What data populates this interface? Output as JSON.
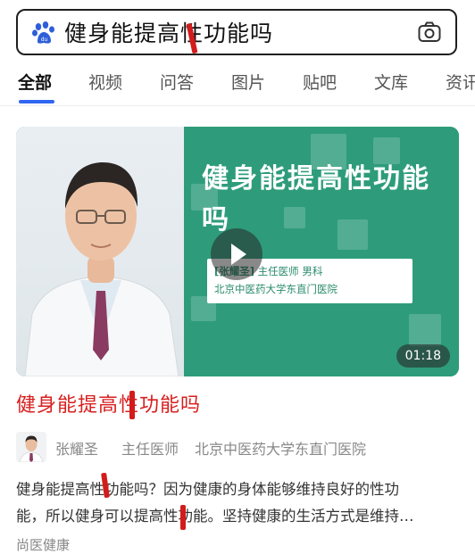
{
  "search": {
    "query": "健身能提高性功能吗",
    "logo_icon": "baidu-paw-icon",
    "camera_icon": "camera-icon"
  },
  "tabs": [
    {
      "label": "全部",
      "active": true
    },
    {
      "label": "视频",
      "active": false
    },
    {
      "label": "问答",
      "active": false
    },
    {
      "label": "图片",
      "active": false
    },
    {
      "label": "贴吧",
      "active": false
    },
    {
      "label": "文库",
      "active": false
    },
    {
      "label": "资讯",
      "active": false
    }
  ],
  "video": {
    "title": "健身能提高性功能吗",
    "doctor_name": "[张耀圣]",
    "doctor_role": "主任医师 男科",
    "hospital": "北京中医药大学东直门医院",
    "duration": "01:18",
    "accent_color": "#2e9c7b"
  },
  "result": {
    "title": "健身能提高性功能吗",
    "author_name": "张耀圣",
    "author_title": "主任医师",
    "author_hospital": "北京中医药大学东直门医院",
    "snippet_line1": "健身能提高性功能吗？因为健康的身体能够维持良好的性功",
    "snippet_line2": "能，所以健身可以提高性功能。坚持健康的生活方式是维持…",
    "source": "尚医健康",
    "title_color": "#d81e1e"
  }
}
